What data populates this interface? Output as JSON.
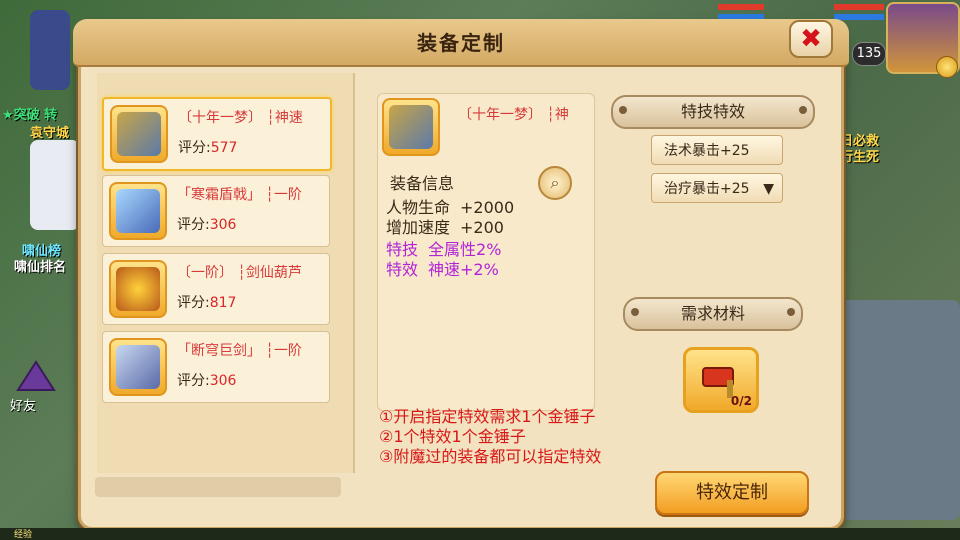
{
  "dialog": {
    "title": "装备定制",
    "close_icon": "close-x-icon"
  },
  "equipment_list": [
    {
      "name": "〔十年一梦〕 ┆神速",
      "score_label": "评分:",
      "score": "577",
      "selected": true,
      "icon": "armor-icon"
    },
    {
      "name": "「寒霜盾戟」 ┆一阶",
      "score_label": "评分:",
      "score": "306",
      "selected": false,
      "icon": "ice-halberd-icon"
    },
    {
      "name": "〔一阶〕 ┆剑仙葫芦",
      "score_label": "评分:",
      "score": "817",
      "selected": false,
      "icon": "gourd-icon"
    },
    {
      "name": "「断穹巨剑」 ┆一阶",
      "score_label": "评分:",
      "score": "306",
      "selected": false,
      "icon": "greatsword-icon"
    }
  ],
  "detail": {
    "name": "〔十年一梦〕 ┆神",
    "info_heading": "装备信息",
    "attributes": [
      {
        "label": "人物生命",
        "value": "+2000",
        "kind": "normal"
      },
      {
        "label": "增加速度",
        "value": "+200",
        "kind": "normal"
      },
      {
        "label": "特技",
        "value": "全属性2%",
        "kind": "special"
      },
      {
        "label": "特效",
        "value": "神速+2%",
        "kind": "special"
      }
    ]
  },
  "notes": [
    "①开启指定特效需求1个金锤子",
    "②1个特效1个金锤子",
    "③附魔过的装备都可以指定特效"
  ],
  "effects_panel": {
    "header": "特技特效",
    "skill": "法术暴击+25",
    "effect": "治疗暴击+25",
    "dropdown_arrow": "▼"
  },
  "materials_panel": {
    "header": "需求材料",
    "item_icon": "golden-hammer-icon",
    "count": "0/2"
  },
  "action_button": "特效定制",
  "hud": {
    "level": "135",
    "friend_label": "好友",
    "exp_label": "经验"
  },
  "background_text": {
    "left1": "★突破 转",
    "left2": "袁守城",
    "left3": "啸仙榜",
    "left4": "啸仙排名",
    "right1": "日必救",
    "right2": "行生死"
  },
  "colors": {
    "panel_bg": "#f3e2bf",
    "title_bar": "#d3a964",
    "red_text": "#d83a3a",
    "purple_text": "#b224d8",
    "button_orange": "#f39e22"
  }
}
